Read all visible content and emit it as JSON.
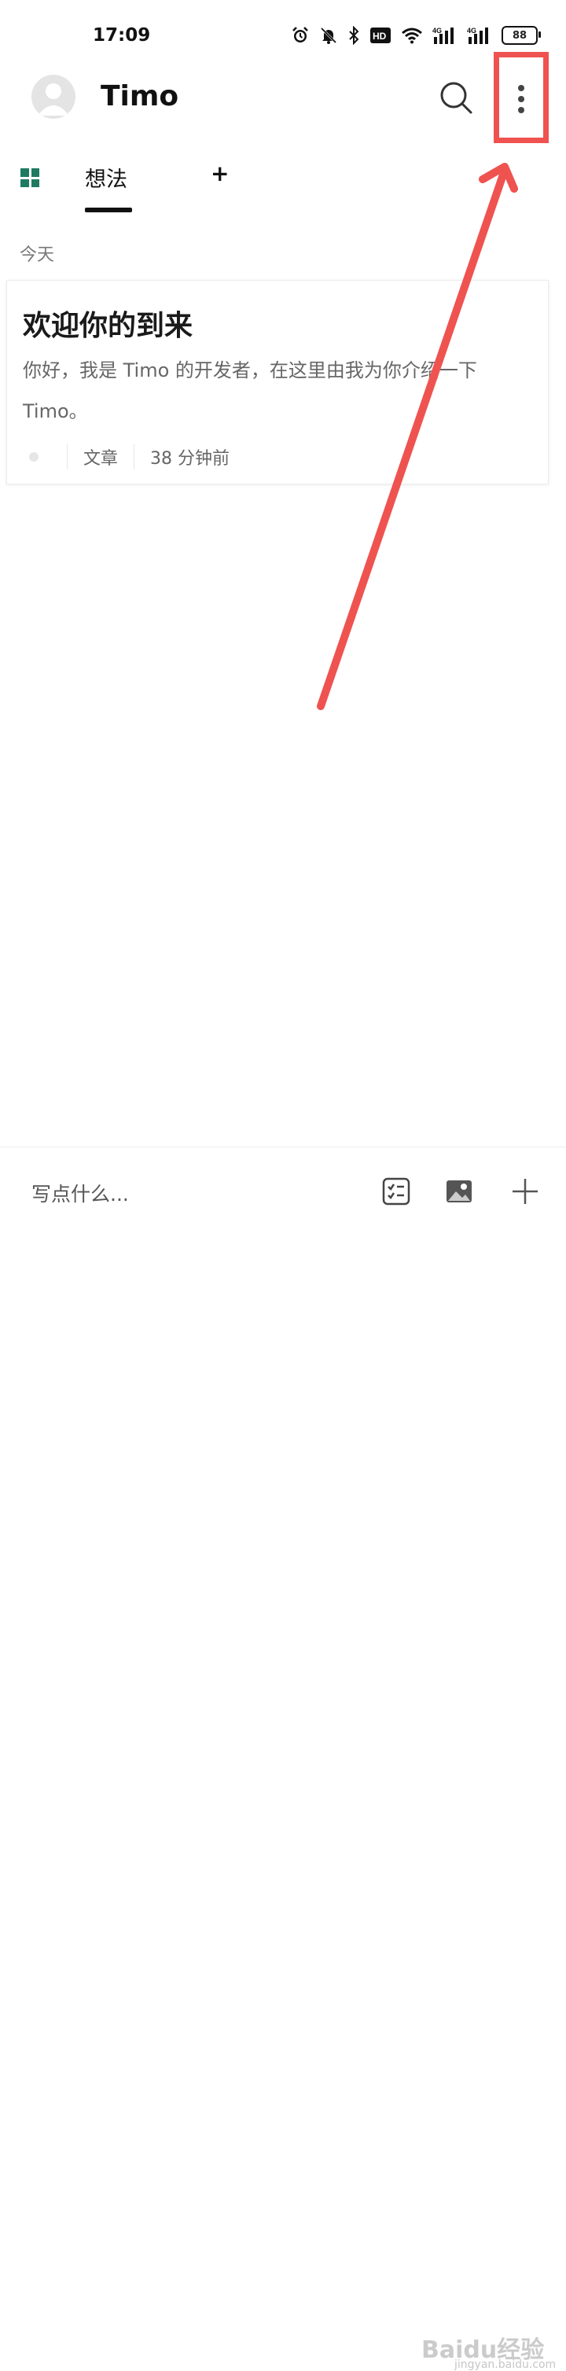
{
  "status_bar": {
    "time": "17:09",
    "battery": "88",
    "icons": [
      "alarm-icon",
      "bell-off-icon",
      "bluetooth-icon",
      "hd-icon",
      "wifi-icon",
      "signal-4g-icon",
      "signal-4g-icon",
      "battery-icon"
    ]
  },
  "header": {
    "title": "Timo"
  },
  "tabs": {
    "active_label": "想法",
    "add_label": "+"
  },
  "feed": {
    "section_label": "今天",
    "cards": [
      {
        "title": "欢迎你的到来",
        "body": "你好，我是 Timo 的开发者，在这里由我为你介绍一下 Timo。",
        "type": "文章",
        "time": "38 分钟前"
      }
    ]
  },
  "compose": {
    "placeholder": "写点什么..."
  },
  "annotation": {
    "color": "#ef5350"
  },
  "watermark": {
    "text": "Baidu经验",
    "sub": "jingyan.baidu.com"
  },
  "colors": {
    "accent_green": "#1e7b62",
    "annotation_red": "#ef5350"
  }
}
